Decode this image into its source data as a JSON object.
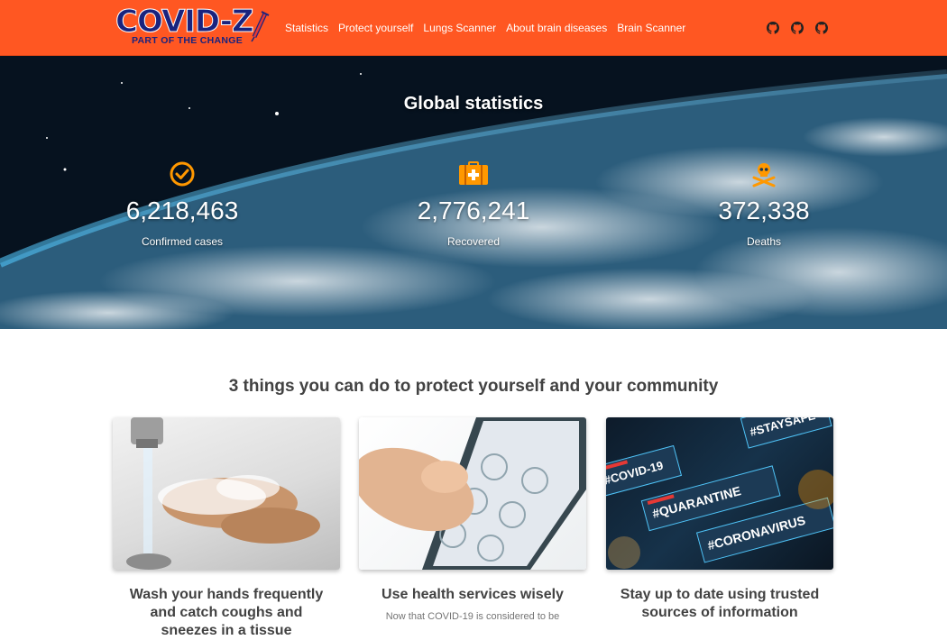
{
  "nav": {
    "logo_main": "COVID-Z",
    "logo_sub": "PART OF THE CHANGE",
    "links": [
      "Statistics",
      "Protect yourself",
      "Lungs Scanner",
      "About brain diseases",
      "Brain Scanner"
    ],
    "icons": [
      "github-icon",
      "github-icon",
      "github-icon"
    ]
  },
  "hero": {
    "title": "Global statistics",
    "stats": [
      {
        "value": "6,218,463",
        "label": "Confirmed cases",
        "icon": "check-circle-icon"
      },
      {
        "value": "2,776,241",
        "label": "Recovered",
        "icon": "medical-kit-icon"
      },
      {
        "value": "372,338",
        "label": "Deaths",
        "icon": "skull-crossbones-icon"
      }
    ]
  },
  "protect": {
    "title": "3 things you can do to protect yourself and your community",
    "cards": [
      {
        "title": "Wash your hands frequently and catch coughs and sneezes in a tissue",
        "text": ""
      },
      {
        "title": "Use health services wisely",
        "text": "Now that COVID-19 is considered to be"
      },
      {
        "title": "Stay up to date using trusted sources of information",
        "text": ""
      }
    ]
  },
  "colors": {
    "accent": "#ff5722",
    "logo": "#1a237e",
    "stat_icon": "#ff9800",
    "heading": "#424242"
  }
}
